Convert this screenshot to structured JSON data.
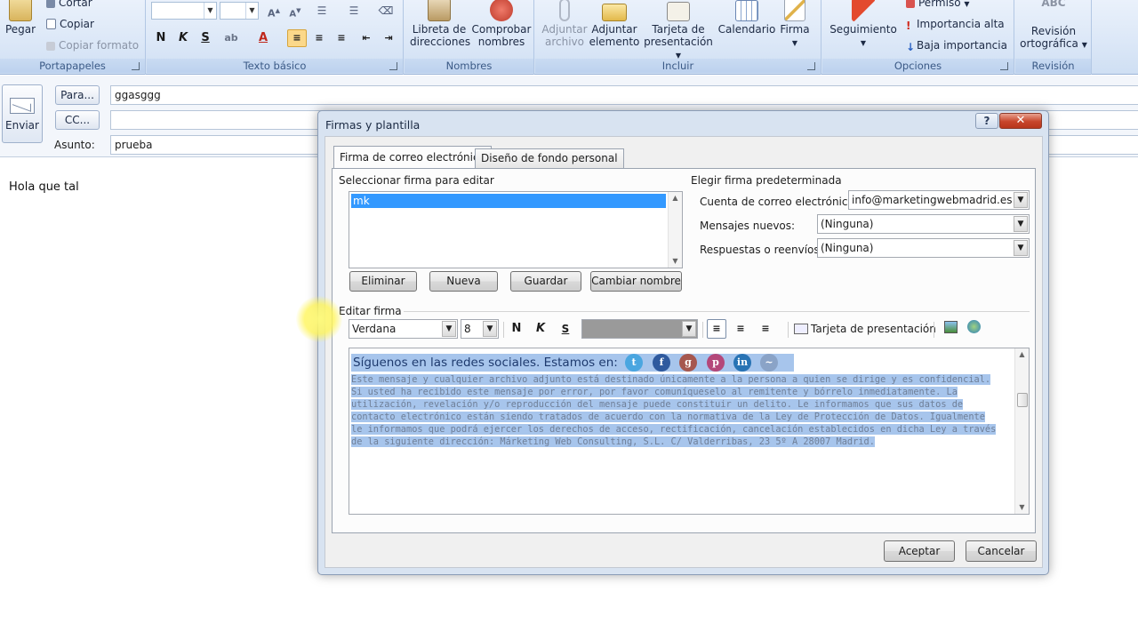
{
  "ribbon": {
    "clipboard": {
      "paste": "Pegar",
      "cut": "Cortar",
      "copy": "Copiar",
      "format_painter": "Copiar formato",
      "label": "Portapapeles"
    },
    "basic_text": {
      "label": "Texto básico"
    },
    "names": {
      "address_book": "Libreta de direcciones",
      "check_names": "Comprobar nombres",
      "label": "Nombres"
    },
    "include": {
      "attach_file": "Adjuntar archivo",
      "attach_item": "Adjuntar elemento",
      "business_card": "Tarjeta de presentación",
      "calendar": "Calendario",
      "signature": "Firma",
      "label": "Incluir"
    },
    "options": {
      "follow_up": "Seguimiento",
      "permission": "Permiso",
      "high_importance": "Importancia alta",
      "low_importance": "Baja importancia",
      "label": "Opciones"
    },
    "proofing": {
      "spelling": "Revisión ortográfica",
      "label": "Revisión"
    }
  },
  "compose": {
    "send": "Enviar",
    "to_button": "Para...",
    "to_value": "ggasggg",
    "cc_button": "CC...",
    "cc_value": "",
    "subject_label": "Asunto:",
    "subject_value": "prueba",
    "body": "Hola que tal"
  },
  "dialog": {
    "title": "Firmas y plantilla",
    "help": "?",
    "close": "✕",
    "tabs": [
      "Firma de correo electrónico",
      "Diseño de fondo personal"
    ],
    "select_signature_label": "Seleccionar firma para editar",
    "signatures": [
      "mk"
    ],
    "buttons": {
      "delete": "Eliminar",
      "new": "Nueva",
      "save": "Guardar",
      "rename": "Cambiar nombre"
    },
    "default_signature": {
      "heading": "Elegir firma predeterminada",
      "account_label": "Cuenta de correo electrónico:",
      "account_value": "info@marketingwebmadrid.es",
      "new_messages_label": "Mensajes nuevos:",
      "new_messages_value": "(Ninguna)",
      "replies_label": "Respuestas o reenvíos:",
      "replies_value": "(Ninguna)"
    },
    "edit_signature_label": "Editar firma",
    "toolbar": {
      "font": "Verdana",
      "size": "8",
      "bold": "N",
      "italic": "K",
      "underline": "S",
      "business_card": "Tarjeta de presentación"
    },
    "signature_content": {
      "social_text": "Síguenos en las redes sociales. Estamos en:",
      "social_icons": [
        "twitter-icon",
        "facebook-icon",
        "google-plus-icon",
        "pinterest-icon",
        "linkedin-icon",
        "other-network-icon"
      ],
      "disclaimer_lines": [
        "Este mensaje y cualquier archivo adjunto está destinado únicamente a la persona a quien se dirige y es confidencial.",
        "Si usted ha recibido este mensaje por error, por favor comuníqueselo al remitente y bórrelo inmediatamente. La",
        "utilización, revelación y/o reproducción del mensaje puede constituir un delito. Le informamos que sus datos de",
        "contacto electrónico están siendo tratados de acuerdo con la normativa de la Ley de Protección de Datos. Igualmente",
        "le informamos que podrá ejercer los derechos de acceso, rectificación, cancelación establecidos en dicha Ley a través",
        "de la siguiente dirección: Márketing Web Consulting, S.L. C/ Valderribas, 23 5º A 28007 Madrid."
      ]
    },
    "accept": "Aceptar",
    "cancel": "Cancelar"
  },
  "colors": {
    "ribbon_bg": "#dbe7f7",
    "selection": "#3399ff",
    "highlight": "#a7c5ec",
    "close_red": "#c7452b"
  }
}
